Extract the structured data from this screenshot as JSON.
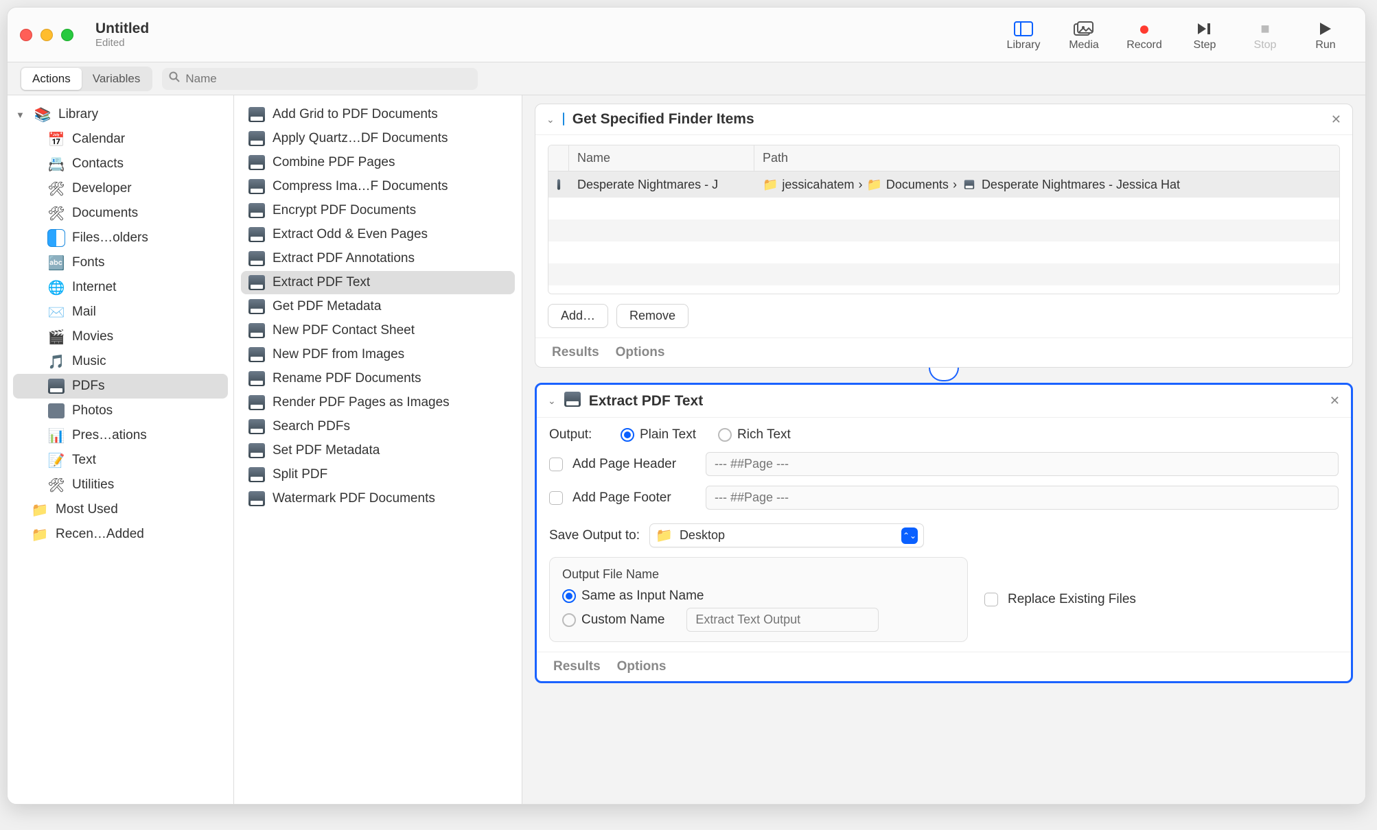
{
  "window": {
    "title": "Untitled",
    "subtitle": "Edited"
  },
  "toolbar": {
    "library": "Library",
    "media": "Media",
    "record": "Record",
    "step": "Step",
    "stop": "Stop",
    "run": "Run"
  },
  "tabs": {
    "actions": "Actions",
    "variables": "Variables"
  },
  "search": {
    "placeholder": "Name"
  },
  "library": {
    "root": "Library",
    "items": [
      "Calendar",
      "Contacts",
      "Developer",
      "Documents",
      "Files…olders",
      "Fonts",
      "Internet",
      "Mail",
      "Movies",
      "Music",
      "PDFs",
      "Photos",
      "Pres…ations",
      "Text",
      "Utilities"
    ],
    "selectedIndex": 10,
    "smart": [
      "Most Used",
      "Recen…Added"
    ]
  },
  "actions": {
    "items": [
      "Add Grid to PDF Documents",
      "Apply Quartz…DF Documents",
      "Combine PDF Pages",
      "Compress Ima…F Documents",
      "Encrypt PDF Documents",
      "Extract Odd & Even Pages",
      "Extract PDF Annotations",
      "Extract PDF Text",
      "Get PDF Metadata",
      "New PDF Contact Sheet",
      "New PDF from Images",
      "Rename PDF Documents",
      "Render PDF Pages as Images",
      "Search PDFs",
      "Set PDF Metadata",
      "Split PDF",
      "Watermark PDF Documents"
    ],
    "selectedIndex": 7
  },
  "workflow": {
    "card1": {
      "title": "Get Specified Finder Items",
      "table": {
        "headers": {
          "name": "Name",
          "path": "Path"
        },
        "row": {
          "name": "Desperate Nightmares - J",
          "path": {
            "folder1": "jessicahatem",
            "folder2": "Documents",
            "file": "Desperate Nightmares - Jessica Hat"
          }
        }
      },
      "buttons": {
        "add": "Add…",
        "remove": "Remove"
      },
      "footer": {
        "results": "Results",
        "options": "Options"
      }
    },
    "card2": {
      "title": "Extract PDF Text",
      "outputLabel": "Output:",
      "plain": "Plain Text",
      "rich": "Rich Text",
      "headerLabel": "Add Page Header",
      "footerLabel": "Add Page Footer",
      "pagePlaceholder": "--- ##Page ---",
      "saveLabel": "Save Output to:",
      "saveValue": "Desktop",
      "groupTitle": "Output File Name",
      "sameAs": "Same as Input Name",
      "custom": "Custom Name",
      "customPlaceholder": "Extract Text Output",
      "replace": "Replace Existing Files",
      "footer": {
        "results": "Results",
        "options": "Options"
      }
    }
  }
}
